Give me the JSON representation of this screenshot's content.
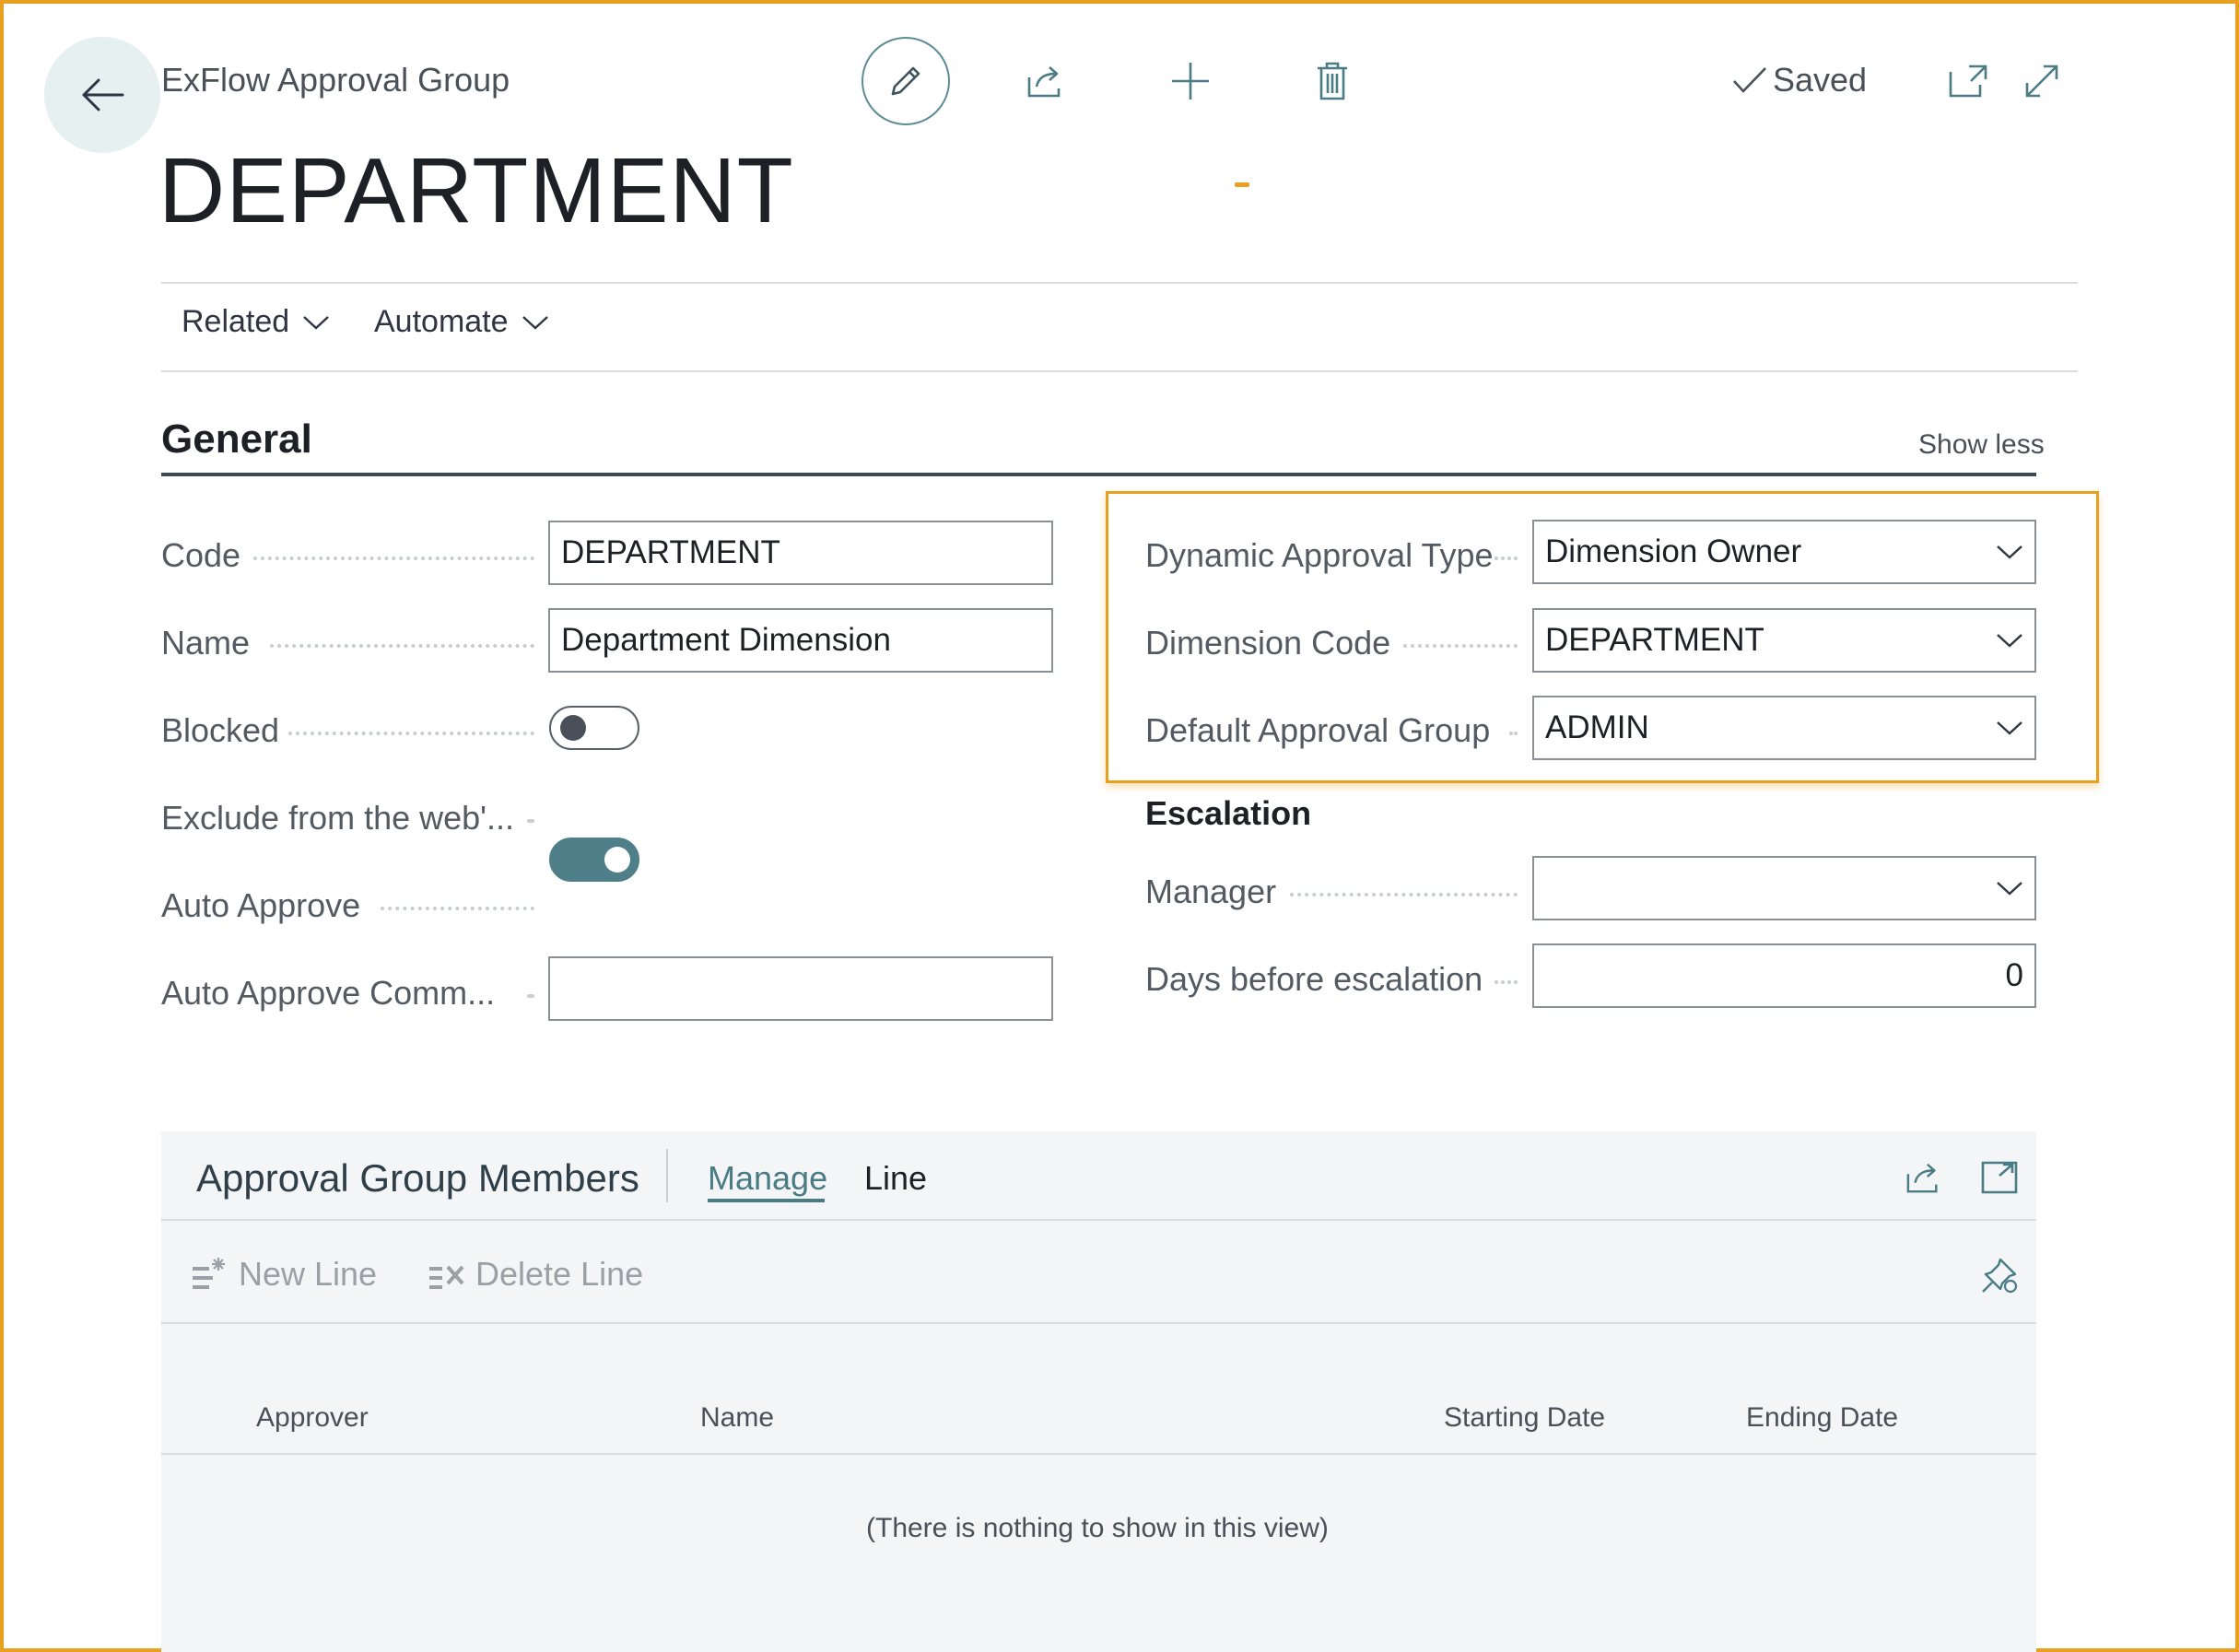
{
  "header": {
    "caption": "ExFlow Approval Group",
    "title": "DEPARTMENT",
    "saved_label": "Saved"
  },
  "menu": {
    "related": "Related",
    "automate": "Automate"
  },
  "general": {
    "title": "General",
    "show_less": "Show less",
    "left_fields": {
      "code": {
        "label": "Code",
        "value": "DEPARTMENT"
      },
      "name": {
        "label": "Name",
        "value": "Department Dimension"
      },
      "blocked": {
        "label": "Blocked",
        "on": false
      },
      "exclude": {
        "label": "Exclude from the web'...",
        "on": true
      },
      "auto_approve": {
        "label": "Auto Approve",
        "on": false
      },
      "auto_approve_comment": {
        "label": "Auto Approve Comm...",
        "value": ""
      }
    },
    "right_fields": {
      "dynamic_approval_type": {
        "label": "Dynamic Approval Type",
        "value": "Dimension Owner"
      },
      "dimension_code": {
        "label": "Dimension Code",
        "value": "DEPARTMENT"
      },
      "default_approval_group": {
        "label": "Default Approval Group",
        "value": "ADMIN"
      }
    },
    "escalation": {
      "title": "Escalation",
      "manager": {
        "label": "Manager",
        "value": ""
      },
      "days": {
        "label": "Days before escalation",
        "value": "0"
      }
    }
  },
  "members": {
    "title": "Approval Group Members",
    "tabs": {
      "manage": "Manage",
      "line": "Line"
    },
    "toolbar": {
      "new_line": "New Line",
      "delete_line": "Delete Line"
    },
    "columns": {
      "approver": "Approver",
      "name": "Name",
      "starting_date": "Starting Date",
      "ending_date": "Ending Date"
    },
    "empty_text": "(There is nothing to show in this view)"
  },
  "colors": {
    "accent": "#4f7f89",
    "highlight": "#e8a020"
  }
}
